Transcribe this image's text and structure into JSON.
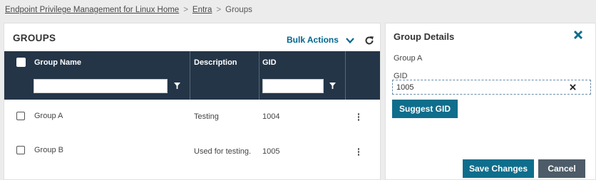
{
  "breadcrumb": {
    "items": [
      "Endpoint Privilege Management for Linux Home",
      "Entra",
      "Groups"
    ],
    "separator": ">"
  },
  "groups_panel": {
    "title": "GROUPS",
    "bulk_actions_label": "Bulk Actions",
    "columns": [
      "Group Name",
      "Description",
      "GID"
    ],
    "rows": [
      {
        "name": "Group A",
        "description": "Testing",
        "gid": "1004"
      },
      {
        "name": "Group B",
        "description": "Used for testing.",
        "gid": "1005"
      }
    ]
  },
  "details_panel": {
    "title": "Group Details",
    "group_name": "Group A",
    "gid_label": "GID",
    "gid_value": "1005",
    "suggest_button": "Suggest GID",
    "save_button": "Save Changes",
    "cancel_button": "Cancel"
  },
  "colors": {
    "accent": "#0f6e8c",
    "header_dark": "#243547",
    "link": "#00668f",
    "cancel": "#4d5c68"
  },
  "icons": {
    "bulk_actions": "chevron-down-icon",
    "refresh": "refresh-icon",
    "filter": "filter-icon",
    "row_menu": "kebab-icon",
    "close": "close-icon",
    "clear": "clear-icon"
  }
}
